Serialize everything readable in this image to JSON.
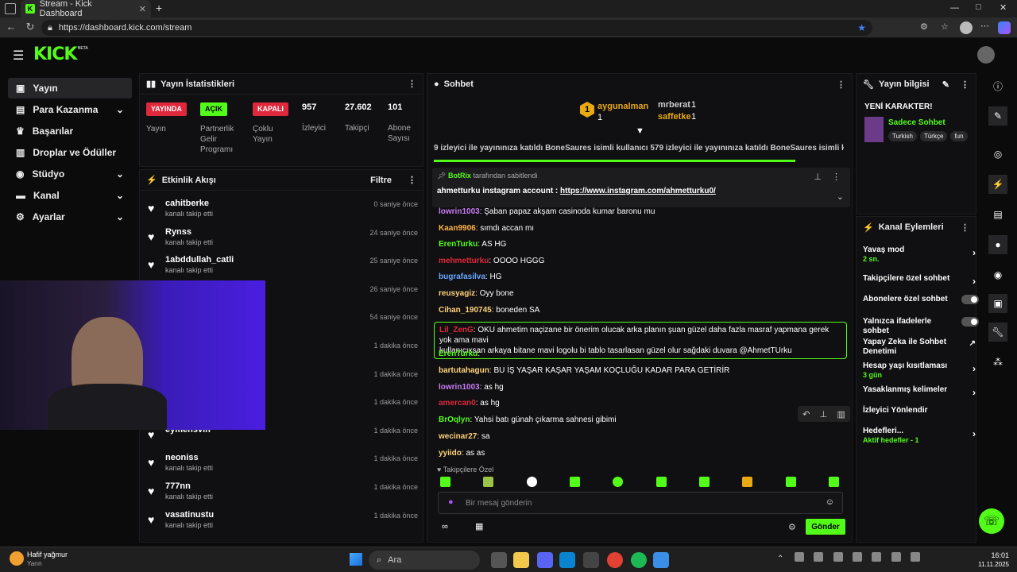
{
  "browser": {
    "tab_title": "Stream - Kick Dashboard",
    "url": "https://dashboard.kick.com/stream",
    "tab_add": "+",
    "win_min": "—",
    "win_max": "□",
    "win_close": "✕"
  },
  "site": {
    "logo": "KICK",
    "logo_beta": "BETA"
  },
  "sidebar": {
    "items": [
      {
        "label": "Yayın",
        "icon": "video-icon"
      },
      {
        "label": "Para Kazanma",
        "icon": "money-icon"
      },
      {
        "label": "Başarılar",
        "icon": "trophy-icon"
      },
      {
        "label": "Droplar ve Ödüller",
        "icon": "gift-icon"
      },
      {
        "label": "Stüdyo",
        "icon": "studio-icon"
      },
      {
        "label": "Kanal",
        "icon": "channel-icon"
      },
      {
        "label": "Ayarlar",
        "icon": "gear-icon"
      }
    ]
  },
  "stats": {
    "title": "Yayın İstatistikleri",
    "live_badge": "YAYINDA",
    "live_label": "Yayın",
    "partner_badge": "AÇIK",
    "partner_label": "Partnerlik Gelir Programı",
    "multi_badge": "KAPALI",
    "multi_label": "Çoklu Yayın",
    "viewers": "957",
    "viewers_label": "İzleyici",
    "followers": "27.602",
    "followers_label": "Takipçi",
    "subs": "101",
    "subs_label": "Abone Sayısı"
  },
  "activity": {
    "title": "Etkinlik Akışı",
    "filter": "Filtre",
    "items": [
      {
        "name": "cahitberke",
        "sub": "kanalı takip etti",
        "time": "0 saniye önce"
      },
      {
        "name": "Rynss",
        "sub": "kanalı takip etti",
        "time": "24 saniye önce"
      },
      {
        "name": "1abddullah_catli",
        "sub": "kanalı takip etti",
        "time": "25 saniye önce"
      },
      {
        "name": "",
        "sub": "",
        "time": "26 saniye önce"
      },
      {
        "name": "",
        "sub": "",
        "time": "54 saniye önce"
      },
      {
        "name": "",
        "sub": "",
        "time": "1 dakika önce"
      },
      {
        "name": "",
        "sub": "",
        "time": "1 dakika önce"
      },
      {
        "name": "",
        "sub": "",
        "time": "1 dakika önce"
      },
      {
        "name": "eymensvin",
        "sub": "",
        "time": "1 dakika önce"
      },
      {
        "name": "neoniss",
        "sub": "kanalı takip etti",
        "time": "1 dakika önce"
      },
      {
        "name": "777nn",
        "sub": "kanalı takip etti",
        "time": "1 dakika önce"
      },
      {
        "name": "vasatinustu",
        "sub": "kanalı takip etti",
        "time": "1 dakika önce"
      }
    ]
  },
  "chat": {
    "title": "Sohbet",
    "leaders": [
      {
        "name": "aygunalman",
        "count": "1",
        "rank": "1"
      },
      {
        "name": "mrberat",
        "count": "1"
      },
      {
        "name": "saffetke",
        "count": "1"
      }
    ],
    "ticker": "9 izleyici ile yayınınıza katıldı  BoneSaures isimli kullanıcı 579 izleyici ile yayınınıza katıldı  BoneSaures isimli ku",
    "pinned_by": "BotRix",
    "pinned_label": "tarafından sabitlendi",
    "pinned_user": "ahmetturku instagram account :",
    "pinned_link": "https://www.instagram.com/ahmetturku0/",
    "messages": [
      {
        "user": "lowrin1003",
        "text": ": Şaban papaz akşam casinoda kumar baronu mu",
        "color": "#c97cf5"
      },
      {
        "user": "Kaan9906",
        "text": ": sımdı accan mı",
        "color": "#ffb347"
      },
      {
        "user": "ErenTurku",
        "text": ": AS HG",
        "color": "#53fc18"
      },
      {
        "user": "mehmetturku",
        "text": ": OOOO HGGG",
        "color": "#e0283c"
      },
      {
        "user": "bugrafasilva",
        "text": ":  HG",
        "color": "#6aa8ff"
      },
      {
        "user": "reusyagiz",
        "text": ": Oyy bone",
        "color": "#ffd27a"
      },
      {
        "user": "Cihan_190745",
        "text": ": boneden SA",
        "color": "#ffd27a"
      },
      {
        "user": "Lil_ZenG",
        "text": ": OKU ahmetim naçizane bir önerim olucak arka planın şuan güzel daha fazla masraf yapmana gerek yok ama mavi",
        "text2": "kullanıcıxsan arkaya bitane mavi logolu bi tablo tasarlasan güzel olur sağdaki duvara @AhmetTUrku",
        "color": "#e0283c"
      },
      {
        "user": "ErenTurku",
        "text": ":",
        "color": "#53fc18"
      },
      {
        "user": "bartutahagun",
        "text": ": BU İŞ YAŞAR KAŞAR YAŞAM KOÇLUĞU KADAR PARA GETİRİR",
        "color": "#ffd27a"
      },
      {
        "user": "lowrin1003",
        "text": ": as hg",
        "color": "#c97cf5"
      },
      {
        "user": "amercan0",
        "text": ": as hg",
        "color": "#e0283c"
      },
      {
        "user": "BrOqlyn",
        "text": ": Yahsi batı günah çıkarma sahnesi gibimi",
        "color": "#53fc18"
      },
      {
        "user": "wecinar27",
        "text": ": sa",
        "color": "#ffd27a"
      },
      {
        "user": "yyiido",
        "text": ": as as",
        "color": "#ffd27a"
      }
    ],
    "followers_only": "Takipçilere Özel",
    "input_placeholder": "Bir mesaj gönderin",
    "send": "Gönder"
  },
  "stream_info": {
    "title": "Yayın bilgisi",
    "stream_title": "YENİ KARAKTER!",
    "category": "Sadece Sohbet",
    "tags": [
      "Turkish",
      "Türkçe",
      "fun"
    ]
  },
  "channel_actions": {
    "title": "Kanal Eylemleri",
    "items": [
      {
        "label": "Yavaş mod",
        "sub": "2 sn.",
        "kind": "chev"
      },
      {
        "label": "Takipçilere özel sohbet",
        "kind": "chev"
      },
      {
        "label": "Abonelere özel sohbet",
        "kind": "toggle"
      },
      {
        "label": "Yalnızca ifadelerle sohbet",
        "kind": "toggle"
      },
      {
        "label": "Yapay Zeka ile Sohbet Denetimi",
        "kind": "ext"
      },
      {
        "label": "Hesap yaşı kısıtlaması",
        "sub": "3 gün",
        "kind": "chev"
      },
      {
        "label": "Yasaklanmış kelimeler",
        "kind": "chev"
      },
      {
        "label": "İzleyici Yönlendir",
        "kind": "none"
      },
      {
        "label": "Hedefleri...",
        "sub": "Aktif hedefler - 1",
        "kind": "chev"
      }
    ]
  },
  "taskbar": {
    "weather": "Hafif yağmur",
    "weather_sub": "Yarın",
    "search": "Ara",
    "time": "16:01",
    "date": "11.11.2025"
  },
  "colors": {
    "accent": "#53fc18",
    "live": "#e0283c"
  }
}
